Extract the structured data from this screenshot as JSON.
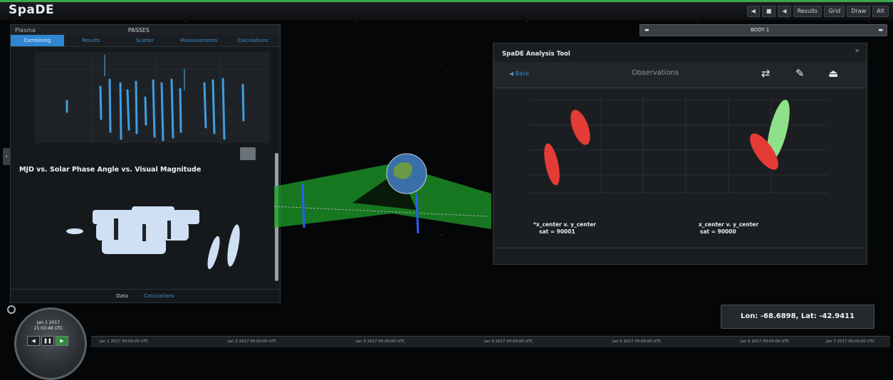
{
  "app": {
    "title": "SpaDE"
  },
  "topbar": {
    "buttons": [
      "◀",
      "■",
      "◀",
      "Results",
      "Grid",
      "Draw",
      "Alt"
    ]
  },
  "left_panel": {
    "header_label": "Plasma",
    "header_title": "PASSES",
    "tabs": [
      "Combining",
      "Results",
      "Scatter",
      "Measurements",
      "Calculations"
    ],
    "chart2_title": "MJD vs. Solar Phase Angle vs. Visual Magnitude",
    "footer": [
      "Data",
      "Calculations"
    ]
  },
  "dropdown": {
    "label": "BODY 1"
  },
  "analysis": {
    "title": "SpaDE Analysis Tool",
    "back_label": "◀ Back",
    "center_label": "Observations",
    "label_left_line1": "*x_center v. y_center",
    "label_left_line2": "sat = 90001",
    "label_right_line1": "x_center v. y_center",
    "label_right_line2": "sat = 90000"
  },
  "coords": {
    "text": "Lon: -68.6898, Lat: -42.9411"
  },
  "clock": {
    "date_line1": "Jan 1 2017",
    "date_line2": "21:02:48 UTC"
  },
  "timeline": {
    "ticks": [
      "Jan 1 2017 00:00:00 UTC",
      "Jan 2 2017 00:00:00 UTC",
      "Jan 3 2017 00:00:00 UTC",
      "Jan 4 2017 00:00:00 UTC",
      "Jan 5 2017 00:00:00 UTC",
      "Jan 6 2017 00:00:00 UTC",
      "Jan 7 2017 00:00:00 UTC"
    ]
  },
  "colors": {
    "accent": "#2f86d3",
    "topbar_stripe": "#3aa74a",
    "series_red": "#e53b36",
    "series_green": "#8fe08a",
    "series_blue": "#3f9ee0",
    "scatter_light": "#cfe0f5",
    "orbit_green": "#1e9e2a"
  }
}
